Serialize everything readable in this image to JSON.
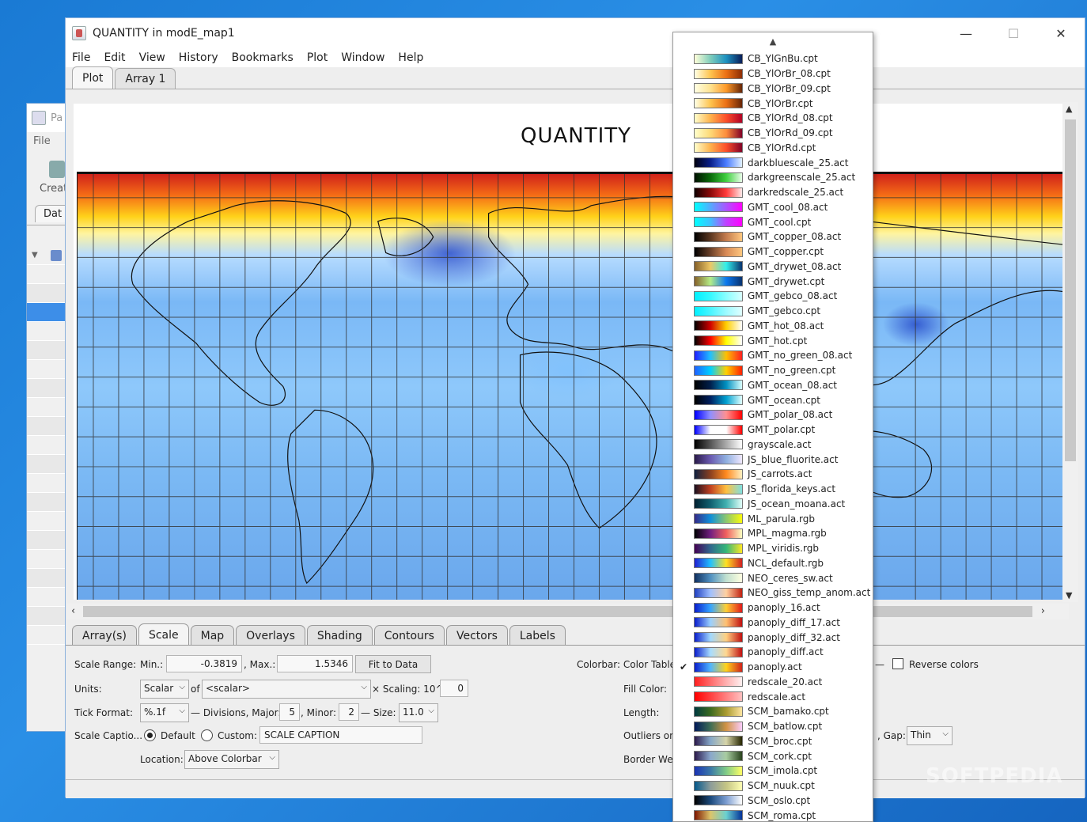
{
  "bg_window": {
    "title_fragment": "Pa",
    "menu": "File",
    "create_label": "Creat",
    "tab_label": "Dat"
  },
  "window": {
    "title": "QUANTITY in modE_map1",
    "controls": {
      "minimize": "—",
      "maximize": "☐",
      "close": "✕"
    }
  },
  "menu": [
    "File",
    "Edit",
    "View",
    "History",
    "Bookmarks",
    "Plot",
    "Window",
    "Help"
  ],
  "top_tabs": [
    {
      "label": "Plot",
      "active": true
    },
    {
      "label": "Array 1",
      "active": false
    }
  ],
  "plot": {
    "title": "QUANTITY"
  },
  "bottom_tabs": [
    {
      "label": "Array(s)",
      "active": false
    },
    {
      "label": "Scale",
      "active": true
    },
    {
      "label": "Map",
      "active": false
    },
    {
      "label": "Overlays",
      "active": false
    },
    {
      "label": "Shading",
      "active": false
    },
    {
      "label": "Contours",
      "active": false
    },
    {
      "label": "Vectors",
      "active": false
    },
    {
      "label": "Labels",
      "active": false
    }
  ],
  "scale": {
    "range_label": "Scale Range:",
    "min_label": "Min.:",
    "min_value": "-0.3819",
    "max_label": ", Max.:",
    "max_value": "1.5346",
    "fit_button": "Fit to Data",
    "units_label": "Units:",
    "units_value": "Scalar",
    "of_label": "of",
    "of_value": "<scalar>",
    "scaling_label": "× Scaling: 10^",
    "scaling_value": "0",
    "tick_format_label": "Tick Format:",
    "tick_format_value": "%.1f",
    "divisions_major_label": "— Divisions, Major:",
    "divisions_major_value": "5",
    "minor_label": ", Minor:",
    "minor_value": "2",
    "size_label": "— Size:",
    "size_value": "11.0",
    "caption_label": "Scale Captio...",
    "default_label": "Default",
    "custom_label": "Custom:",
    "custom_value": "SCALE CAPTION",
    "location_label": "Location:",
    "location_value": "Above Colorbar"
  },
  "colorbar": {
    "color_table_label": "Colorbar:  Color Table",
    "reverse_label": "Reverse colors",
    "fill_color_label": "Fill Color:",
    "length_label": "Length:",
    "outliers_label": "Outliers on",
    "gap_label": ", Gap:",
    "gap_value": "Thin",
    "border_label": "Border We"
  },
  "color_tables": [
    {
      "name": "CB_YlGnBu.cpt",
      "colors": [
        "#ffffd9",
        "#7fcdbb",
        "#1d91c0",
        "#081d58"
      ]
    },
    {
      "name": "CB_YlOrBr_08.cpt",
      "colors": [
        "#ffffe5",
        "#fec44f",
        "#ec7014",
        "#8c2d04"
      ]
    },
    {
      "name": "CB_YlOrBr_09.cpt",
      "colors": [
        "#ffffe5",
        "#fee391",
        "#fe9929",
        "#662506"
      ]
    },
    {
      "name": "CB_YlOrBr.cpt",
      "colors": [
        "#ffffe5",
        "#fec44f",
        "#ec7014",
        "#662506"
      ]
    },
    {
      "name": "CB_YlOrRd_08.cpt",
      "colors": [
        "#ffffcc",
        "#feb24c",
        "#fc4e2a",
        "#b10026"
      ]
    },
    {
      "name": "CB_YlOrRd_09.cpt",
      "colors": [
        "#ffffcc",
        "#fed976",
        "#fd8d3c",
        "#800026"
      ]
    },
    {
      "name": "CB_YlOrRd.cpt",
      "colors": [
        "#ffffcc",
        "#feb24c",
        "#fc4e2a",
        "#800026"
      ]
    },
    {
      "name": "darkbluescale_25.act",
      "colors": [
        "#000010",
        "#0a1f8a",
        "#4a7cff",
        "#e0f0ff"
      ]
    },
    {
      "name": "darkgreenscale_25.act",
      "colors": [
        "#001000",
        "#0a6a0a",
        "#3fd03f",
        "#e8ffe8"
      ]
    },
    {
      "name": "darkredscale_25.act",
      "colors": [
        "#100000",
        "#8a0a0a",
        "#ff3a3a",
        "#ffe8e8"
      ]
    },
    {
      "name": "GMT_cool_08.act",
      "colors": [
        "#00ffff",
        "#55aaff",
        "#aa55ff",
        "#ff00ff"
      ]
    },
    {
      "name": "GMT_cool.cpt",
      "colors": [
        "#00ffff",
        "#40bfff",
        "#bf40ff",
        "#ff00ff"
      ]
    },
    {
      "name": "GMT_copper_08.act",
      "colors": [
        "#000000",
        "#5a3620",
        "#c47c4e",
        "#ffc77f"
      ]
    },
    {
      "name": "GMT_copper.cpt",
      "colors": [
        "#000000",
        "#6a4028",
        "#d88a56",
        "#ffc77f"
      ]
    },
    {
      "name": "GMT_drywet_08.act",
      "colors": [
        "#86612a",
        "#eec764",
        "#32eeeb",
        "#08326e"
      ]
    },
    {
      "name": "GMT_drywet.cpt",
      "colors": [
        "#86612a",
        "#b4ee87",
        "#0c78ee",
        "#08326e"
      ]
    },
    {
      "name": "GMT_gebco_08.act",
      "colors": [
        "#00f0ff",
        "#35f9ff",
        "#8affff",
        "#d7ffff"
      ]
    },
    {
      "name": "GMT_gebco.cpt",
      "colors": [
        "#00f0ff",
        "#4af5ff",
        "#9dfbff",
        "#e0ffff"
      ]
    },
    {
      "name": "GMT_hot_08.act",
      "colors": [
        "#000000",
        "#d00000",
        "#ffd000",
        "#ffffff"
      ]
    },
    {
      "name": "GMT_hot.cpt",
      "colors": [
        "#000000",
        "#ff0000",
        "#ffff00",
        "#ffffff"
      ]
    },
    {
      "name": "GMT_no_green_08.act",
      "colors": [
        "#2020ff",
        "#20c0ff",
        "#ffc000",
        "#ff2020"
      ]
    },
    {
      "name": "GMT_no_green.cpt",
      "colors": [
        "#2060ff",
        "#00d0ff",
        "#ffd000",
        "#ff2000"
      ]
    },
    {
      "name": "GMT_ocean_08.act",
      "colors": [
        "#000000",
        "#001f4c",
        "#0090c0",
        "#d8ffff"
      ]
    },
    {
      "name": "GMT_ocean.cpt",
      "colors": [
        "#000000",
        "#002060",
        "#00a0d0",
        "#e0ffff"
      ]
    },
    {
      "name": "GMT_polar_08.act",
      "colors": [
        "#0000ff",
        "#9090ff",
        "#ff9090",
        "#ff0000"
      ]
    },
    {
      "name": "GMT_polar.cpt",
      "colors": [
        "#0000ff",
        "#ffffff",
        "#ffffff",
        "#ff0000"
      ]
    },
    {
      "name": "grayscale.act",
      "colors": [
        "#000000",
        "#555555",
        "#aaaaaa",
        "#ffffff"
      ]
    },
    {
      "name": "JS_blue_fluorite.act",
      "colors": [
        "#2a1a4a",
        "#6a5ab0",
        "#8fb0e0",
        "#f0e8ff"
      ]
    },
    {
      "name": "JS_carrots.act",
      "colors": [
        "#102040",
        "#8a4020",
        "#ff8a20",
        "#fff0c0"
      ]
    },
    {
      "name": "JS_florida_keys.act",
      "colors": [
        "#1a1020",
        "#c04020",
        "#ffc040",
        "#80e0e0"
      ]
    },
    {
      "name": "JS_ocean_moana.act",
      "colors": [
        "#002030",
        "#106070",
        "#40b0b0",
        "#e0fff8"
      ]
    },
    {
      "name": "ML_parula.rgb",
      "colors": [
        "#352a87",
        "#0f8fd9",
        "#8dc76f",
        "#f9fb0e"
      ]
    },
    {
      "name": "MPL_magma.rgb",
      "colors": [
        "#000004",
        "#721f81",
        "#f1605d",
        "#fcfdbf"
      ]
    },
    {
      "name": "MPL_viridis.rgb",
      "colors": [
        "#440154",
        "#31688e",
        "#35b779",
        "#fde725"
      ]
    },
    {
      "name": "NCL_default.rgb",
      "colors": [
        "#2020d0",
        "#20c0ff",
        "#ffe020",
        "#d02020"
      ]
    },
    {
      "name": "NEO_ceres_sw.act",
      "colors": [
        "#103060",
        "#5090c0",
        "#c0e0d0",
        "#ffffe0"
      ]
    },
    {
      "name": "NEO_giss_temp_anom.act",
      "colors": [
        "#2040c0",
        "#a0c0ff",
        "#ffd0a0",
        "#c02010"
      ]
    },
    {
      "name": "panoply_16.act",
      "colors": [
        "#0a1ecc",
        "#34a3ff",
        "#ffcf33",
        "#e01a1a"
      ]
    },
    {
      "name": "panoply_diff_17.act",
      "colors": [
        "#0a1ecc",
        "#9ad0ff",
        "#ffc070",
        "#c01010"
      ]
    },
    {
      "name": "panoply_diff_32.act",
      "colors": [
        "#0a1ecc",
        "#a0d8ff",
        "#ffd080",
        "#c01010"
      ]
    },
    {
      "name": "panoply_diff.act",
      "colors": [
        "#0a1ecc",
        "#a8dcff",
        "#ffd890",
        "#c01010"
      ]
    },
    {
      "name": "panoply.act",
      "colors": [
        "#0a1ecc",
        "#4fb5ff",
        "#ffd21a",
        "#d0221a"
      ],
      "checked": true
    },
    {
      "name": "redscale_20.act",
      "colors": [
        "#ff2020",
        "#ff6a6a",
        "#ffb0b0",
        "#fff0f0"
      ]
    },
    {
      "name": "redscale.act",
      "colors": [
        "#ff0000",
        "#ff4040",
        "#ff8080",
        "#ffc0c0"
      ]
    },
    {
      "name": "SCM_bamako.cpt",
      "colors": [
        "#003a40",
        "#3a6a20",
        "#aa9a30",
        "#ffe5a0"
      ]
    },
    {
      "name": "SCM_batlow.cpt",
      "colors": [
        "#011959",
        "#3c6d56",
        "#d29343",
        "#faccfa"
      ]
    },
    {
      "name": "SCM_broc.cpt",
      "colors": [
        "#2c1a4c",
        "#86a8c8",
        "#d6d4a8",
        "#262600"
      ]
    },
    {
      "name": "SCM_cork.cpt",
      "colors": [
        "#2c1a4c",
        "#8aa8cc",
        "#a8cca0",
        "#28421c"
      ]
    },
    {
      "name": "SCM_imola.cpt",
      "colors": [
        "#1a33b3",
        "#3a78a8",
        "#80cc88",
        "#ffff66"
      ]
    },
    {
      "name": "SCM_nuuk.cpt",
      "colors": [
        "#05598c",
        "#8c9c9a",
        "#c4c484",
        "#fefeb2"
      ]
    },
    {
      "name": "SCM_oslo.cpt",
      "colors": [
        "#010101",
        "#1b4a7c",
        "#7a9cd0",
        "#ffffff"
      ]
    },
    {
      "name": "SCM_roma.cpt",
      "colors": [
        "#7e1700",
        "#dcc46a",
        "#6ad0d0",
        "#023198"
      ]
    }
  ],
  "watermark": "SOFTPEDIA"
}
